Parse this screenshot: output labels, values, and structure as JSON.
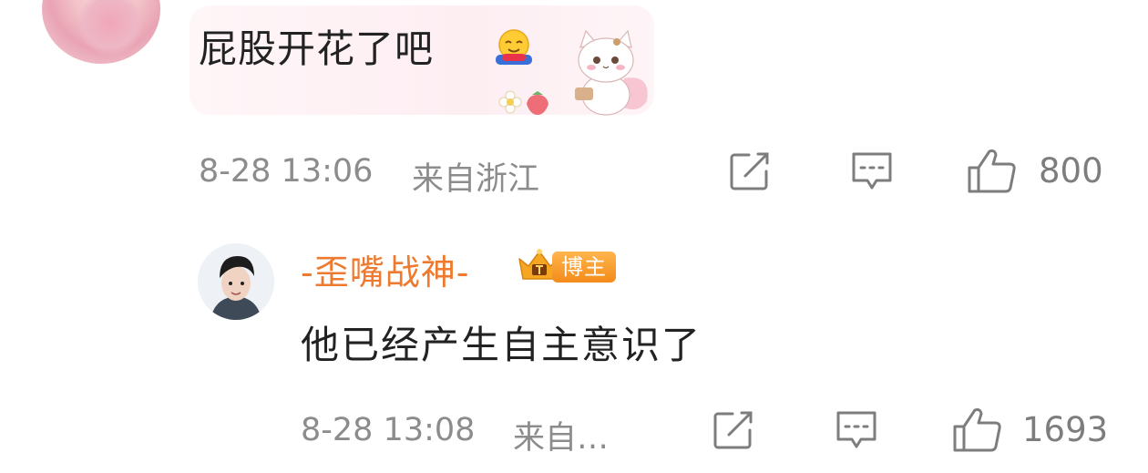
{
  "comment1": {
    "text": "屁股开花了吧",
    "emoji": "hugging-face-emoji",
    "time": "8-28 13:06",
    "location": "来自浙江",
    "like_count": "800"
  },
  "comment2": {
    "username": "-歪嘴战神-",
    "badge": "博主",
    "text": "他已经产生自主意识了",
    "time": "8-28 13:08",
    "location": "来自…",
    "like_count": "1693"
  },
  "colors": {
    "username": "#ee7a2f",
    "badge": "#f38b1a",
    "meta": "#8c8c8c"
  }
}
